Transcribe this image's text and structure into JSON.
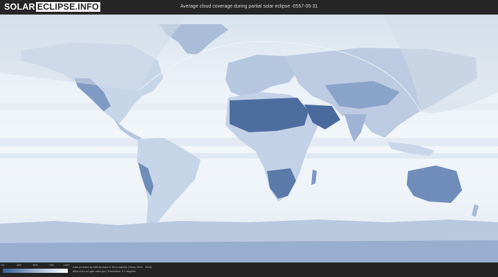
{
  "header": {
    "logo_part1": "SOLAR",
    "logo_part2": "ECLIPSE.INFO",
    "title": "Average cloud coverage during partial solar eclipse -0557-05-31"
  },
  "map": {
    "description_colors": {
      "ocean_cloud": "#eef3f9",
      "clear_sky": "#4b6a9c",
      "night_overlay": "#d9e1ea"
    }
  },
  "legend": {
    "labels": [
      "0%",
      "25%",
      "50%",
      "75%",
      "100%"
    ],
    "gradient_start": "#3d5f95",
    "gradient_end": "#ffffff"
  },
  "credits": {
    "line1": "Data provided by NASAs Aqua & Terra satellite (Years: 2000 - 2019)",
    "line2": "https://neo.sci.gsfc.nasa.gov | Resolution: 0.1 degrees"
  }
}
